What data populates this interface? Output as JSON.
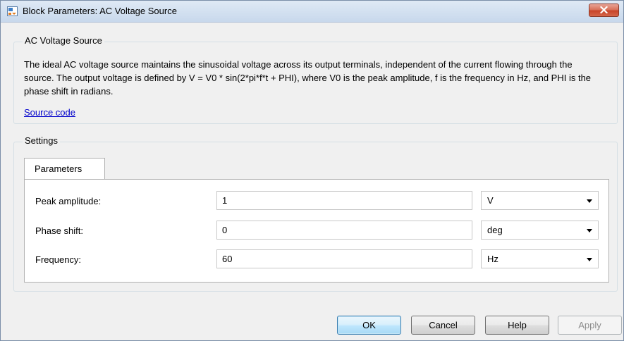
{
  "window": {
    "title": "Block Parameters: AC Voltage Source",
    "close_icon": "close-icon"
  },
  "description_group": {
    "title": "AC Voltage Source",
    "text": "The ideal AC voltage source maintains the sinusoidal voltage across its output terminals, independent of the current flowing through the source. The output voltage is defined by  V = V0 * sin(2*pi*f*t + PHI), where V0 is the peak amplitude, f is the frequency in Hz, and PHI is the phase shift in radians.",
    "link": "Source code"
  },
  "settings_group": {
    "title": "Settings",
    "tab": "Parameters",
    "rows": [
      {
        "label": "Peak amplitude:",
        "value": "1",
        "unit": "V"
      },
      {
        "label": "Phase shift:",
        "value": "0",
        "unit": "deg"
      },
      {
        "label": "Frequency:",
        "value": "60",
        "unit": "Hz"
      }
    ]
  },
  "buttons": {
    "ok": "OK",
    "cancel": "Cancel",
    "help": "Help",
    "apply": "Apply"
  },
  "colors": {
    "titlebar": "#d2e0f0",
    "close_button": "#c8452a",
    "link": "#0000cc",
    "ok_button": "#bee6fd"
  }
}
